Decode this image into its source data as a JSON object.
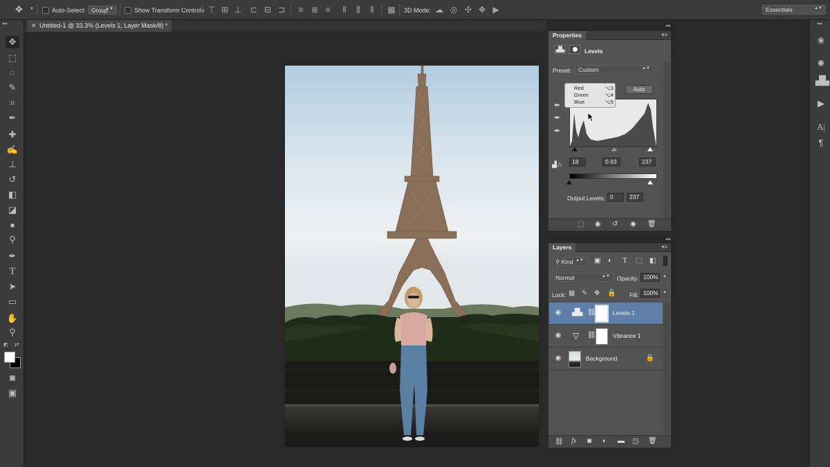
{
  "options_bar": {
    "auto_select_label": "Auto-Select:",
    "auto_select_value": "Group",
    "transform_controls_label": "Show Transform Controls",
    "mode_3d_label": "3D Mode:",
    "workspace": "Essentials"
  },
  "document": {
    "tab_title": "Untitled-1 @ 33.3% (Levels 1, Layer Mask/8) *"
  },
  "properties": {
    "panel_title": "Properties",
    "adjustment_title": "Levels",
    "preset_label": "Preset:",
    "preset_value": "Custom",
    "auto_label": "Auto",
    "channel_menu": [
      {
        "label": "Red",
        "shortcut": "⌥3"
      },
      {
        "label": "Green",
        "shortcut": "⌥4"
      },
      {
        "label": "Blue",
        "shortcut": "⌥5"
      }
    ],
    "input_black": "18",
    "input_gamma": "0.93",
    "input_white": "237",
    "output_label": "Output Levels:",
    "output_black": "0",
    "output_white": "237"
  },
  "layers": {
    "panel_title": "Layers",
    "filter_kind": "Kind",
    "blend_mode": "Normal",
    "opacity_label": "Opacity:",
    "opacity_value": "100%",
    "lock_label": "Lock:",
    "fill_label": "Fill:",
    "fill_value": "100%",
    "items": [
      {
        "name": "Levels 1",
        "selected": true
      },
      {
        "name": "Vibrance 1",
        "selected": false
      },
      {
        "name": "Background",
        "selected": false
      }
    ]
  },
  "colors": {
    "selection": "#5f7fa8",
    "panel_bg": "#535353",
    "app_bg": "#282828"
  }
}
